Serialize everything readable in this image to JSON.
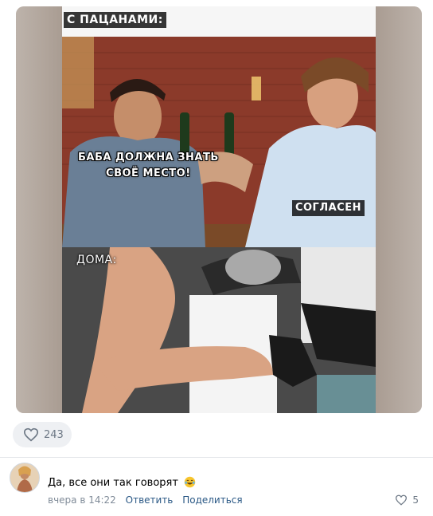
{
  "post": {
    "meme": {
      "caption_top": "С ПАЦАНАМИ:",
      "caption_speech": "БАБА ДОЛЖНА ЗНАТЬ\nСВОЁ МЕСТО!",
      "caption_reply": "СОГЛАСЕН",
      "caption_bottom": "ДОМА:"
    },
    "reactions": {
      "icon": "heart-icon",
      "count": "243"
    }
  },
  "comment": {
    "text": "Да, все они так говорят",
    "emoji": "laughing-tears-emoji",
    "time": "вчера в 14:22",
    "reply_label": "Ответить",
    "share_label": "Поделиться",
    "likes": "5"
  },
  "colors": {
    "link": "#2a5885",
    "meta": "#818c99",
    "reaction_bg": "#eef0f3"
  }
}
